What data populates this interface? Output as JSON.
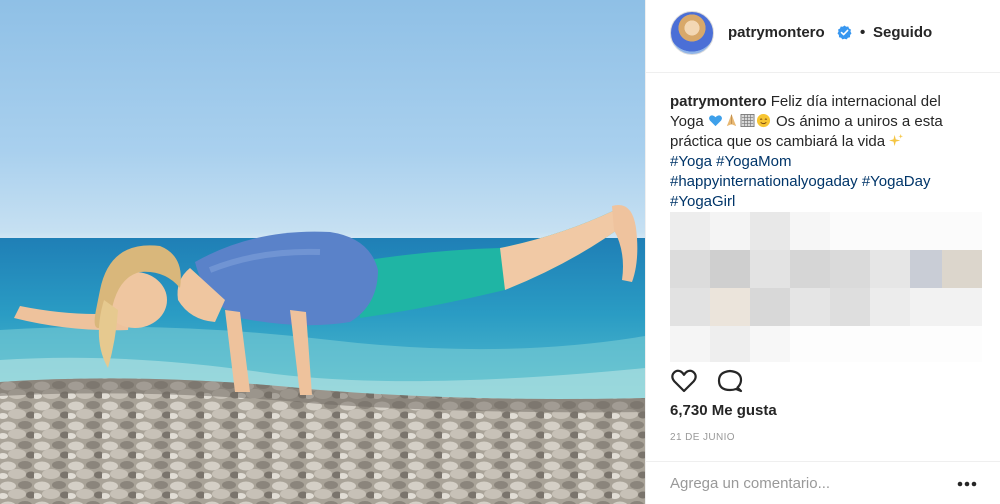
{
  "post": {
    "username": "patrymontero",
    "follow_status": "Seguido",
    "separator": "•",
    "caption": {
      "username": "patrymontero",
      "text_line1": "Feliz día internacional del",
      "text_line2_start": "Yoga",
      "text_line2_end": "Os ánimo a uniros a esta",
      "text_line3": "práctica que os cambiará la vida",
      "hashtags_line1": "#Yoga #YogaMom",
      "hashtags_line2": "#happyinternationalyogaday #YogaDay",
      "hashtags_line3": "#YogaGirl",
      "emojis": [
        "blue-heart-icon",
        "praying-hands-icon",
        "abacus-icon",
        "smiling-face-icon",
        "sparkles-icon"
      ]
    },
    "likes_text": "6,730 Me gusta",
    "date_text": "21 DE JUNIO",
    "comment_placeholder": "Agrega un comentario...",
    "icons": [
      "verified-badge-icon",
      "heart-icon",
      "comment-icon",
      "more-options-icon"
    ],
    "colors": {
      "hashtag": "#003569",
      "text": "#262626",
      "muted": "#999999",
      "verified": "#3897f0",
      "border": "#efefef"
    }
  }
}
